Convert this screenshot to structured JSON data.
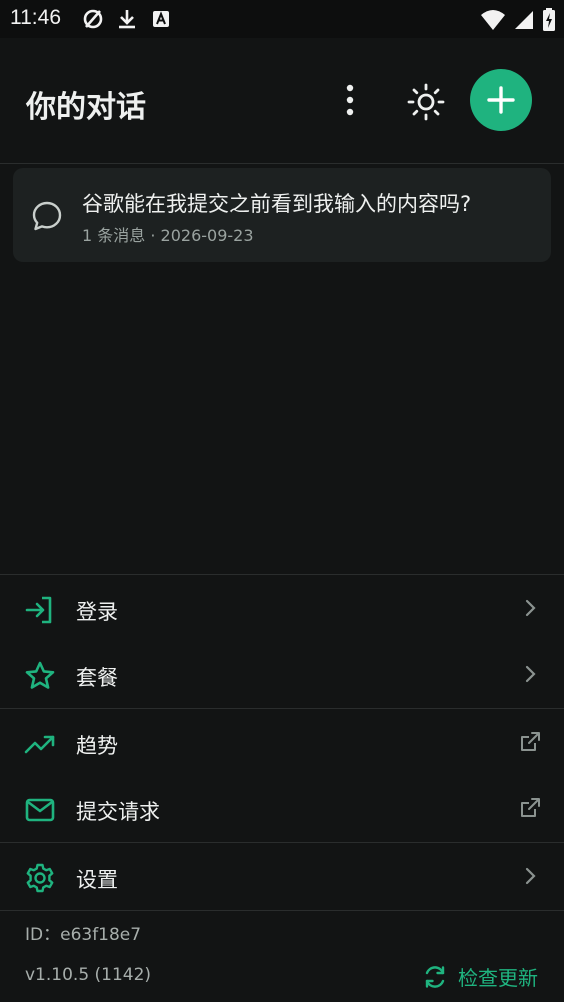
{
  "status_bar": {
    "time": "11:46"
  },
  "header": {
    "title": "你的对话"
  },
  "conversations": [
    {
      "title": "谷歌能在我提交之前看到我输入的内容吗?",
      "meta": "1 条消息 · 2026-09-23"
    }
  ],
  "menu": {
    "login": "登录",
    "plans": "套餐",
    "trends": "趋势",
    "submit_request": "提交请求",
    "settings": "设置"
  },
  "footer": {
    "id": "ID：e63f18e7",
    "version": "v1.10.5 (1142)",
    "check_update": "检查更新"
  },
  "colors": {
    "accent": "#1fb37f",
    "background": "#121414",
    "card": "#1d2121",
    "divider": "#2a2d2d"
  }
}
